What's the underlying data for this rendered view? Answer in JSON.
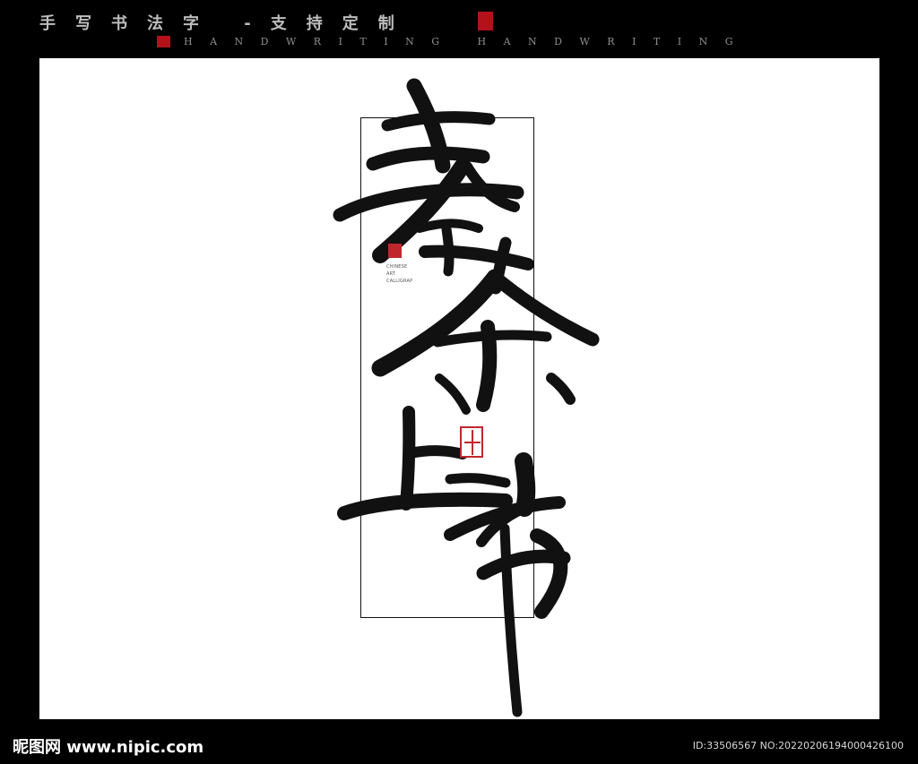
{
  "header": {
    "title": "手写书法字 -支持定制",
    "subtitle": "HANDWRITING HANDWRITING"
  },
  "artwork": {
    "seal_caption": "CHINESE\nART\nCALLIGRAP"
  },
  "footer": {
    "logo_text": "昵图网 www.nipic.com",
    "id_text": "ID:33506567 NO:20220206194000426100"
  },
  "colors": {
    "background": "#000000",
    "canvas": "#ffffff",
    "ink": "#111111",
    "seal_red": "#c0272d"
  }
}
